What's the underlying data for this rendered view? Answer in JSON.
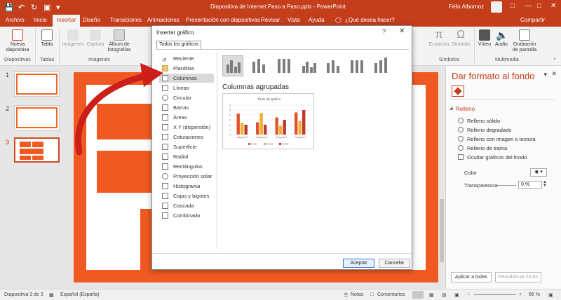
{
  "window": {
    "title": "Diapositiva de Internet Paso a Paso.pptx  -  PowerPoint",
    "user": "Félix Albornoz",
    "share_label": "Compartir"
  },
  "ribbon": {
    "tabs": [
      "Archivo",
      "Inicio",
      "Insertar",
      "Diseño",
      "Transiciones",
      "Animaciones",
      "Presentación con diapositivas",
      "Revisar",
      "Vista",
      "Ayuda"
    ],
    "tell_me": "¿Qué desea hacer?",
    "buttons": {
      "new_slide": "Nueva diapositiva",
      "table": "Tabla",
      "images": "Imágenes",
      "capture": "Captura",
      "album": "Álbum de fotografías",
      "equation": "Ecuación",
      "symbol": "Símbolo",
      "video": "Vídeo",
      "audio": "Audio",
      "screen_recording": "Grabación de pantalla"
    },
    "groups": {
      "slides": "Diapositivas",
      "tables": "Tablas",
      "images": "Imágenes",
      "symbols": "Símbolos",
      "multimedia": "Multimedia"
    }
  },
  "thumbnails": [
    "1",
    "2",
    "3"
  ],
  "dialog": {
    "title": "Insertar gráfico",
    "help": "?",
    "close": "✕",
    "tab": "Todos los gráficos",
    "categories": [
      "Reciente",
      "Plantillas",
      "Columnas",
      "Líneas",
      "Circular",
      "Barras",
      "Áreas",
      "X Y (dispersión)",
      "Cotizaciones",
      "Superficie",
      "Radial",
      "Rectángulos",
      "Proyección solar",
      "Histograma",
      "Cajas y bigotes",
      "Cascada",
      "Combinado"
    ],
    "selected_category": "Columnas",
    "subtype_title": "Columnas agrupadas",
    "ok": "Aceptar",
    "cancel": "Cancelar"
  },
  "chart_data": {
    "type": "bar",
    "title": "Título del gráfico",
    "categories": [
      "Categoría 1",
      "Categoría 2",
      "Categoría 3",
      "Categoría 4"
    ],
    "series": [
      {
        "name": "Serie1",
        "values": [
          4.3,
          2.5,
          3.5,
          4.5
        ],
        "color": "#e0542c"
      },
      {
        "name": "Serie2",
        "values": [
          2.4,
          4.4,
          1.8,
          2.8
        ],
        "color": "#f0b033"
      },
      {
        "name": "Serie3",
        "values": [
          2,
          2,
          3,
          5
        ],
        "color": "#c0392b"
      }
    ],
    "ylim": [
      0,
      6
    ]
  },
  "format_pane": {
    "title": "Dar formato al fondo",
    "fill_header": "Relleno",
    "options": [
      "Relleno sólido",
      "Relleno degradado",
      "Relleno con imagen o textura",
      "Relleno de trama"
    ],
    "hide_graphics": "Ocultar gráficos del fondo",
    "color_label": "Color",
    "transparency_label": "Transparencia",
    "transparency_value": "0 %",
    "apply_all": "Aplicar a todas",
    "reset": "Restablecer fondo"
  },
  "status": {
    "slide_info": "Diapositiva 3 de 3",
    "language": "Español (España)",
    "notes": "Notas",
    "comments": "Comentarios",
    "zoom": "66 %"
  },
  "colors": {
    "accent": "#c43e1c",
    "slide_orange": "#f05a22"
  }
}
